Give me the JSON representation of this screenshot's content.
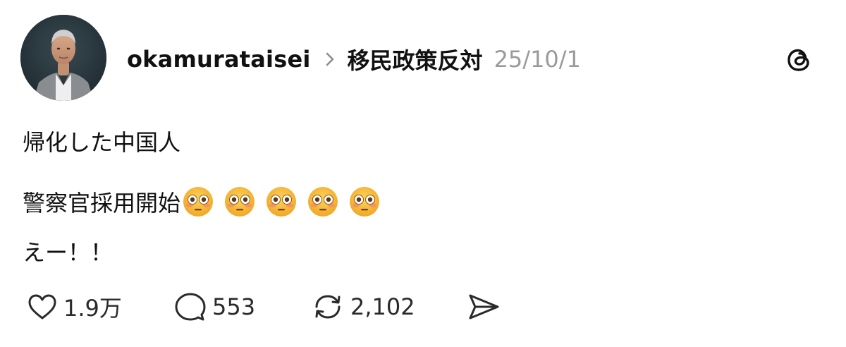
{
  "post": {
    "username": "okamurataisei",
    "topic": "移民政策反対",
    "date": "25/10/1",
    "lines": [
      "帰化した中国人",
      "警察官採用開始",
      "えー！！"
    ],
    "emojis": [
      "flushed-face-emoji",
      "flushed-face-emoji",
      "flushed-face-emoji",
      "flushed-face-emoji",
      "flushed-face-emoji"
    ]
  },
  "actions": {
    "likes": "1.9万",
    "replies": "553",
    "reposts": "2,102"
  },
  "icons": {
    "like": "heart-icon",
    "reply": "speech-bubble-icon",
    "repost": "repost-icon",
    "share": "send-icon",
    "app": "threads-logo-icon"
  },
  "colors": {
    "text": "#111111",
    "muted": "#9a9a9a",
    "emoji_face": "#f7b531"
  }
}
